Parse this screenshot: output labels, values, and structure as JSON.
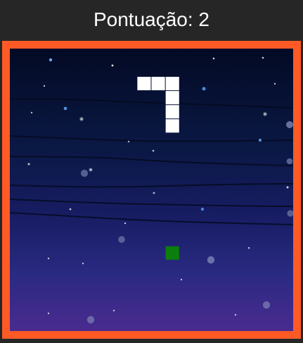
{
  "header": {
    "score_label": "Pontuação: 2"
  },
  "game": {
    "score": 2,
    "colors": {
      "border": "#ff5a26",
      "snake": "#ffffff",
      "food": "#0b7f0b",
      "sky_top": "#030a24",
      "sky_mid": "#141a5a",
      "sky_bottom": "#452a8f"
    },
    "grid": {
      "columns": 20,
      "rows": 20
    },
    "snake": [
      [
        9,
        2
      ],
      [
        10,
        2
      ],
      [
        11,
        2
      ],
      [
        11,
        3
      ],
      [
        11,
        4
      ],
      [
        11,
        5
      ]
    ],
    "food": [
      11,
      14
    ]
  }
}
